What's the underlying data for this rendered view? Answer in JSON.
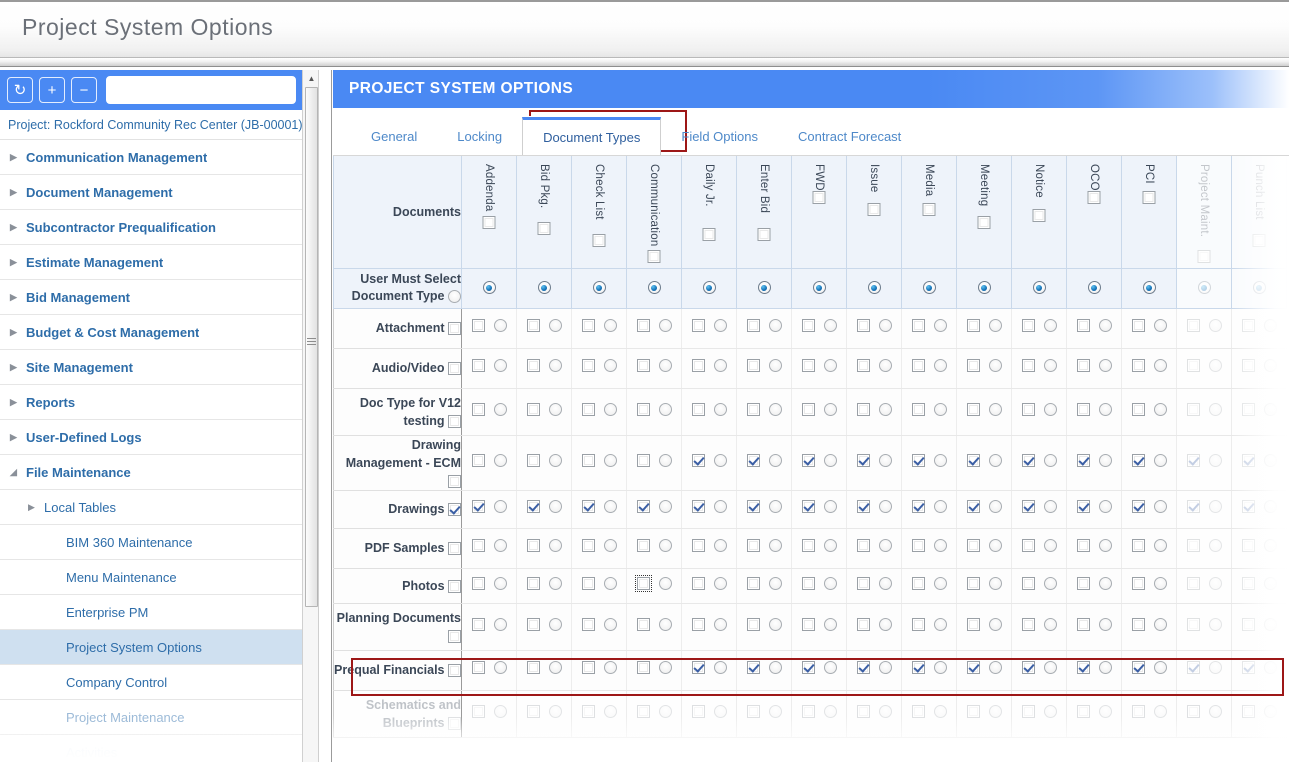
{
  "window": {
    "title": "Project System Options"
  },
  "sidebar": {
    "toolbar": {
      "refresh_label": "↻",
      "add_label": "+",
      "remove_label": "−",
      "search_value": "",
      "search_placeholder": "",
      "go_label": "⌕"
    },
    "project_line": "Project: Rockford Community Rec Center (JB-00001)",
    "items": [
      {
        "label": "Communication Management",
        "type": "group",
        "caret": "▶"
      },
      {
        "label": "Document Management",
        "type": "group",
        "caret": "▶"
      },
      {
        "label": "Subcontractor Prequalification",
        "type": "group",
        "caret": "▶"
      },
      {
        "label": "Estimate Management",
        "type": "group",
        "caret": "▶"
      },
      {
        "label": "Bid Management",
        "type": "group",
        "caret": "▶"
      },
      {
        "label": "Budget & Cost Management",
        "type": "group",
        "caret": "▶"
      },
      {
        "label": "Site Management",
        "type": "group",
        "caret": "▶"
      },
      {
        "label": "Reports",
        "type": "group",
        "caret": "▶"
      },
      {
        "label": "User-Defined Logs",
        "type": "group",
        "caret": "▶"
      },
      {
        "label": "File Maintenance",
        "type": "group-open",
        "caret": "◢"
      },
      {
        "label": "Local Tables",
        "type": "child-group",
        "caret": "▶"
      },
      {
        "label": "BIM 360 Maintenance",
        "type": "child"
      },
      {
        "label": "Menu Maintenance",
        "type": "child"
      },
      {
        "label": "Enterprise PM",
        "type": "child"
      },
      {
        "label": "Project System Options",
        "type": "child",
        "selected": true
      },
      {
        "label": "Company Control",
        "type": "child"
      },
      {
        "label": "Project Maintenance",
        "type": "child",
        "faded": true
      },
      {
        "label": "Activities",
        "type": "child",
        "faded2": true
      }
    ]
  },
  "main": {
    "panel_title": "PROJECT SYSTEM OPTIONS",
    "tabs": [
      {
        "label": "General",
        "active": false
      },
      {
        "label": "Locking",
        "active": false
      },
      {
        "label": "Document Types",
        "active": true,
        "highlighted": true
      },
      {
        "label": "Field Options",
        "active": false
      },
      {
        "label": "Contract Forecast",
        "active": false
      }
    ],
    "grid": {
      "corner_label": "Documents",
      "user_must_select_label": "User Must Select Document Type",
      "user_must_select_checked": false,
      "columns": [
        {
          "label": "Addenda",
          "header_checked": false,
          "ums_selected": true,
          "faded": false
        },
        {
          "label": "Bid Pkg.",
          "header_checked": false,
          "ums_selected": true,
          "faded": false
        },
        {
          "label": "Check List",
          "header_checked": false,
          "ums_selected": true,
          "faded": false
        },
        {
          "label": "Communication",
          "header_checked": false,
          "ums_selected": true,
          "faded": false
        },
        {
          "label": "Daily Jr.",
          "header_checked": false,
          "ums_selected": true,
          "faded": false
        },
        {
          "label": "Enter Bid",
          "header_checked": false,
          "ums_selected": true,
          "faded": false
        },
        {
          "label": "FWD",
          "header_checked": false,
          "ums_selected": true,
          "faded": false
        },
        {
          "label": "Issue",
          "header_checked": false,
          "ums_selected": true,
          "faded": false
        },
        {
          "label": "Media",
          "header_checked": false,
          "ums_selected": true,
          "faded": false
        },
        {
          "label": "Meeting",
          "header_checked": false,
          "ums_selected": true,
          "faded": false
        },
        {
          "label": "Notice",
          "header_checked": false,
          "ums_selected": true,
          "faded": false
        },
        {
          "label": "OCO",
          "header_checked": false,
          "ums_selected": true,
          "faded": false
        },
        {
          "label": "PCI",
          "header_checked": false,
          "ums_selected": true,
          "faded": false
        },
        {
          "label": "Project Maint.",
          "header_checked": false,
          "ums_selected": true,
          "faded": true
        },
        {
          "label": "Punch List",
          "header_checked": false,
          "ums_selected": true,
          "faded": true
        }
      ],
      "rows": [
        {
          "label": "Attachment",
          "row_checked": false,
          "faded": false,
          "highlighted": false,
          "checks": [
            false,
            false,
            false,
            false,
            false,
            false,
            false,
            false,
            false,
            false,
            false,
            false,
            false,
            false,
            false
          ],
          "radios": [
            false,
            false,
            false,
            false,
            false,
            false,
            false,
            false,
            false,
            false,
            false,
            false,
            false,
            false,
            false
          ]
        },
        {
          "label": "Audio/Video",
          "row_checked": false,
          "faded": false,
          "highlighted": false,
          "checks": [
            false,
            false,
            false,
            false,
            false,
            false,
            false,
            false,
            false,
            false,
            false,
            false,
            false,
            false,
            false
          ],
          "radios": [
            false,
            false,
            false,
            false,
            false,
            false,
            false,
            false,
            false,
            false,
            false,
            false,
            false,
            false,
            false
          ]
        },
        {
          "label": "Doc Type for V12 testing",
          "row_checked": false,
          "faded": false,
          "highlighted": false,
          "checks": [
            false,
            false,
            false,
            false,
            false,
            false,
            false,
            false,
            false,
            false,
            false,
            false,
            false,
            false,
            false
          ],
          "radios": [
            false,
            false,
            false,
            false,
            false,
            false,
            false,
            false,
            false,
            false,
            false,
            false,
            false,
            false,
            false
          ]
        },
        {
          "label": "Drawing Management - ECM",
          "row_checked": false,
          "faded": false,
          "highlighted": false,
          "checks": [
            false,
            false,
            false,
            false,
            true,
            true,
            true,
            true,
            true,
            true,
            true,
            true,
            true,
            true,
            true
          ],
          "radios": [
            false,
            false,
            false,
            false,
            false,
            false,
            false,
            false,
            false,
            false,
            false,
            false,
            false,
            false,
            false
          ]
        },
        {
          "label": "Drawings",
          "row_checked": true,
          "faded": false,
          "highlighted": true,
          "checks": [
            true,
            true,
            true,
            true,
            true,
            true,
            true,
            true,
            true,
            true,
            true,
            true,
            true,
            true,
            true
          ],
          "radios": [
            false,
            false,
            false,
            false,
            false,
            false,
            false,
            false,
            false,
            false,
            false,
            false,
            false,
            false,
            false
          ]
        },
        {
          "label": "PDF Samples",
          "row_checked": false,
          "faded": false,
          "highlighted": false,
          "checks": [
            false,
            false,
            false,
            false,
            false,
            false,
            false,
            false,
            false,
            false,
            false,
            false,
            false,
            false,
            false
          ],
          "radios": [
            false,
            false,
            false,
            false,
            false,
            false,
            false,
            false,
            false,
            false,
            false,
            false,
            false,
            false,
            false
          ]
        },
        {
          "label": "Photos",
          "row_checked": false,
          "faded": false,
          "highlighted": false,
          "focus_col": 3,
          "checks": [
            false,
            false,
            false,
            false,
            false,
            false,
            false,
            false,
            false,
            false,
            false,
            false,
            false,
            false,
            false
          ],
          "radios": [
            false,
            false,
            false,
            false,
            false,
            false,
            false,
            false,
            false,
            false,
            false,
            false,
            false,
            false,
            false
          ]
        },
        {
          "label": "Planning Documents",
          "row_checked": false,
          "faded": false,
          "highlighted": false,
          "checks": [
            false,
            false,
            false,
            false,
            false,
            false,
            false,
            false,
            false,
            false,
            false,
            false,
            false,
            false,
            false
          ],
          "radios": [
            false,
            false,
            false,
            false,
            false,
            false,
            false,
            false,
            false,
            false,
            false,
            false,
            false,
            false,
            false
          ]
        },
        {
          "label": "Prequal Financials",
          "row_checked": false,
          "faded": false,
          "highlighted": false,
          "checks": [
            false,
            false,
            false,
            false,
            true,
            true,
            true,
            true,
            true,
            true,
            true,
            true,
            true,
            true,
            true
          ],
          "radios": [
            false,
            false,
            false,
            false,
            false,
            false,
            false,
            false,
            false,
            false,
            false,
            false,
            false,
            false,
            false
          ]
        },
        {
          "label": "Schematics and Blueprints",
          "row_checked": false,
          "faded": true,
          "highlighted": false,
          "checks": [
            false,
            false,
            false,
            false,
            false,
            false,
            false,
            false,
            false,
            false,
            false,
            false,
            false,
            false,
            false
          ],
          "radios": [
            false,
            false,
            false,
            false,
            false,
            false,
            false,
            false,
            false,
            false,
            false,
            false,
            false,
            false,
            false
          ]
        }
      ]
    }
  }
}
